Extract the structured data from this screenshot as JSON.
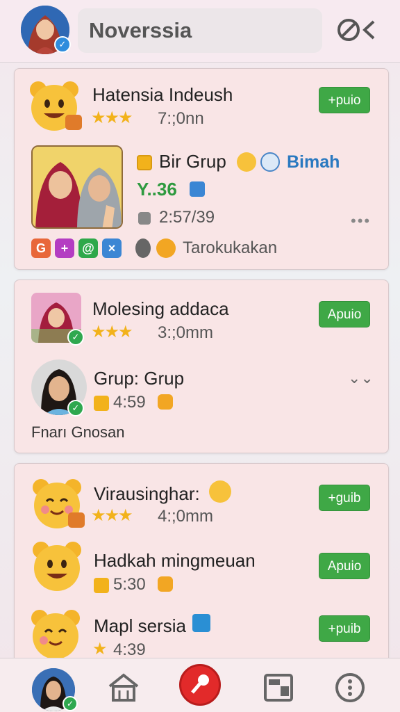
{
  "header": {
    "search_value": "Noverssia"
  },
  "cards": [
    {
      "title": "Hatensia Indeush",
      "stars": "★★★",
      "time": "7:;0nn",
      "join_label": "+puio",
      "group_title": "Bir Grup",
      "group_mention": "Bimah",
      "group_price": "Y..36",
      "group_time": "2:57/39",
      "reaction_text": "Tarokukakan"
    },
    {
      "title": "Molesing addaca",
      "stars": "★★★",
      "time": "3:;0mm",
      "join_label": "Apuio",
      "sub_title": "Grup: Grup",
      "sub_time": "4:59",
      "footer_text": "Fnarı Gnosan"
    },
    {
      "rows": [
        {
          "title": "Virausinghar:",
          "stars": "★★★",
          "time": "4:;0mm",
          "join_label": "+guib"
        },
        {
          "title": "Hadkah mingmeuan",
          "time": "5:30",
          "join_label": "Apuio"
        },
        {
          "title": "Mapl sersia",
          "stars": "★",
          "time": "4:39",
          "join_label": "+puib"
        }
      ]
    }
  ]
}
